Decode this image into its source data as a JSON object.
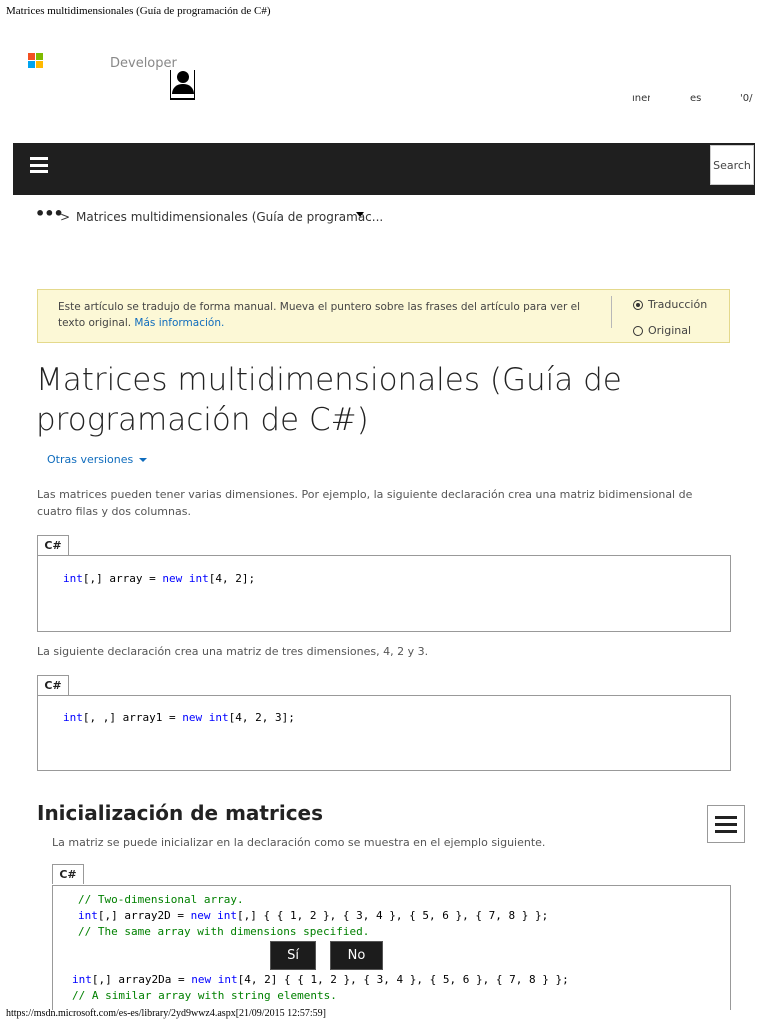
{
  "print_header": "Matrices multidimensionales (Guía de programación de C#)",
  "site": {
    "developer_label": "Developer",
    "util_a": "ıner",
    "util_b": "es",
    "util_c": "'0/"
  },
  "colors": {
    "ms_red": "#f25022",
    "ms_green": "#7fba00",
    "ms_blue": "#00a4ef",
    "ms_yellow": "#ffb900",
    "link": "#0f6cbd",
    "navbar": "#1f1f1f"
  },
  "nav": {
    "search_label": "Search"
  },
  "breadcrumb": {
    "dots": "•••",
    "separator": ">",
    "current": "Matrices multidimensionales (Guía de programac..."
  },
  "translation": {
    "text": "Este artículo se tradujo de forma manual. Mueva el puntero sobre las frases del artículo para ver el texto original.",
    "link": "Más información.",
    "option_translation": "Traducción",
    "option_original": "Original"
  },
  "page_title": "Matrices multidimensionales (Guía de programación de C#)",
  "other_versions": "Otras versiones",
  "intro": "Las matrices pueden tener varias dimensiones. Por ejemplo, la siguiente declaración crea una matriz bidimensional de cuatro filas y dos columnas.",
  "code1": {
    "tab": "C#",
    "kw1": "int",
    "p1": "[,] array = ",
    "kw2": "new",
    "p2": " ",
    "kw3": "int",
    "p3": "[4, 2];"
  },
  "para2": "La siguiente declaración crea una matriz de tres dimensiones, 4, 2 y 3.",
  "code2": {
    "tab": "C#",
    "kw1": "int",
    "p1": "[, ,] array1 = ",
    "kw2": "new",
    "p2": " ",
    "kw3": "int",
    "p3": "[4, 2, 3];"
  },
  "section": {
    "heading": "Inicialización de matrices",
    "para": "La matriz se puede inicializar en la declaración como se muestra en el ejemplo siguiente."
  },
  "code3": {
    "tab": "C#",
    "l1": "// Two-dimensional array.",
    "l2_kw1": "int",
    "l2_a": "[,] array2D = ",
    "l2_kw2": "new",
    "l2_b": " ",
    "l2_kw3": "int",
    "l2_c": "[,] { { 1, 2 }, { 3, 4 }, { 5, 6 }, { 7, 8 } };",
    "l3": "// The same array with dimensions specified.",
    "l4_kw1": "int",
    "l4_a": "[,] array2Da = ",
    "l4_kw2": "new",
    "l4_b": " ",
    "l4_kw3": "int",
    "l4_c": "[4, 2] { { 1, 2 }, { 3, 4 }, { 5, 6 }, { 7, 8 } };",
    "l5": "// A similar array with string elements."
  },
  "feedback": {
    "yes": "Sí",
    "no": "No"
  },
  "print_footer": "https://msdn.microsoft.com/es-es/library/2yd9wwz4.aspx[21/09/2015 12:57:59]"
}
